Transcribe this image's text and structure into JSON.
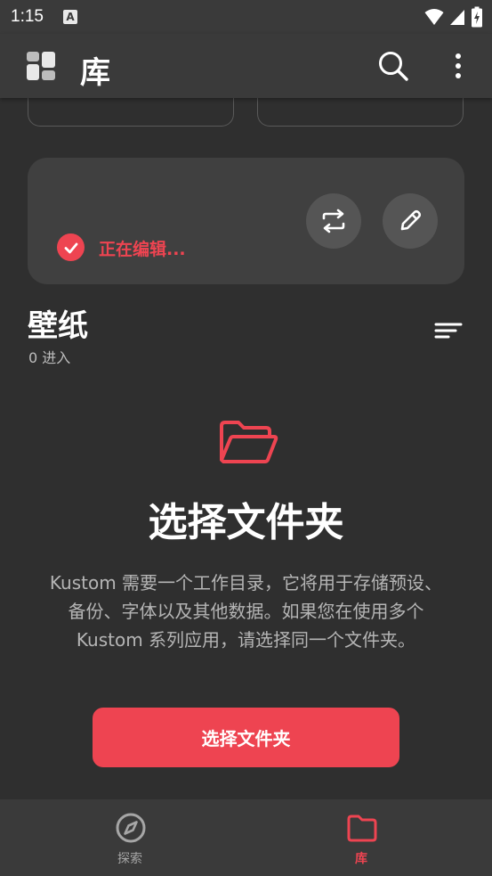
{
  "status_bar": {
    "time": "1:15",
    "notification_icon_letter": "A",
    "icons": [
      "wifi-icon",
      "signal-icon",
      "battery-charging-icon"
    ]
  },
  "app_bar": {
    "title": "库",
    "icons": [
      "app-logo-icon",
      "search-icon",
      "more-vert-icon"
    ]
  },
  "edit_card": {
    "status_text": "正在编辑...",
    "icons": [
      "check-circle-icon",
      "swap-icon",
      "pencil-icon"
    ]
  },
  "section": {
    "title": "壁纸",
    "count": "0 进入",
    "icons": [
      "sort-icon"
    ]
  },
  "empty_state": {
    "title": "选择文件夹",
    "description": "Kustom 需要一个工作目录，它将用于存储预设、备份、字体以及其他数据。如果您在使用多个 Kustom 系列应用，请选择同一个文件夹。",
    "button_label": "选择文件夹",
    "icon": "folder-open-icon"
  },
  "bottom_nav": {
    "items": [
      {
        "label": "探索",
        "icon": "compass-icon",
        "active": false
      },
      {
        "label": "库",
        "icon": "folder-icon",
        "active": true
      }
    ]
  },
  "colors": {
    "accent": "#ee4451",
    "background": "#2f2f2f",
    "surface": "#3a3a3a",
    "card": "#404040"
  }
}
